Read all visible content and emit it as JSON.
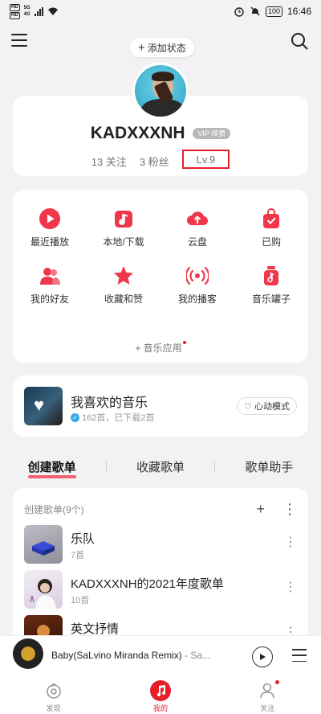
{
  "status_bar": {
    "sim1": "HD",
    "sim2": "HD",
    "net1": "5G",
    "net2": "4G",
    "battery": "100",
    "time": "16:46"
  },
  "header": {
    "add_status": "添加状态"
  },
  "profile": {
    "username": "KADXXXNH",
    "vip_badge": "VIP 续费",
    "following": "13 关注",
    "fans": "3 粉丝",
    "level": "Lv.9"
  },
  "shortcuts": [
    {
      "label": "最近播放",
      "icon": "play-icon"
    },
    {
      "label": "本地/下载",
      "icon": "music-note-icon"
    },
    {
      "label": "云盘",
      "icon": "cloud-upload-icon"
    },
    {
      "label": "已购",
      "icon": "bag-check-icon"
    },
    {
      "label": "我的好友",
      "icon": "friends-icon"
    },
    {
      "label": "收藏和赞",
      "icon": "star-icon"
    },
    {
      "label": "我的播客",
      "icon": "podcast-icon"
    },
    {
      "label": "音乐罐子",
      "icon": "music-jar-icon"
    }
  ],
  "music_apps": "音乐应用",
  "liked_music": {
    "title": "我喜欢的音乐",
    "subtitle": "162首，已下载2首",
    "heart_mode": "心动模式"
  },
  "tabs": [
    "创建歌单",
    "收藏歌单",
    "歌单助手"
  ],
  "playlists": {
    "header": "创建歌单(9个)",
    "items": [
      {
        "name": "乐队",
        "count": "7首"
      },
      {
        "name": "KADXXXNH的2021年度歌单",
        "count": "10首"
      },
      {
        "name": "英文抒情",
        "count": ""
      }
    ]
  },
  "mini_player": {
    "title": "Baby(SaLvino Miranda Remix)",
    "artist": " - Sa..."
  },
  "bottom_nav": [
    {
      "label": "发现",
      "icon": "discover-icon"
    },
    {
      "label": "我的",
      "icon": "music-icon"
    },
    {
      "label": "关注",
      "icon": "person-icon"
    }
  ],
  "colors": {
    "accent": "#e6202a",
    "highlight_box": "#e6202a"
  }
}
